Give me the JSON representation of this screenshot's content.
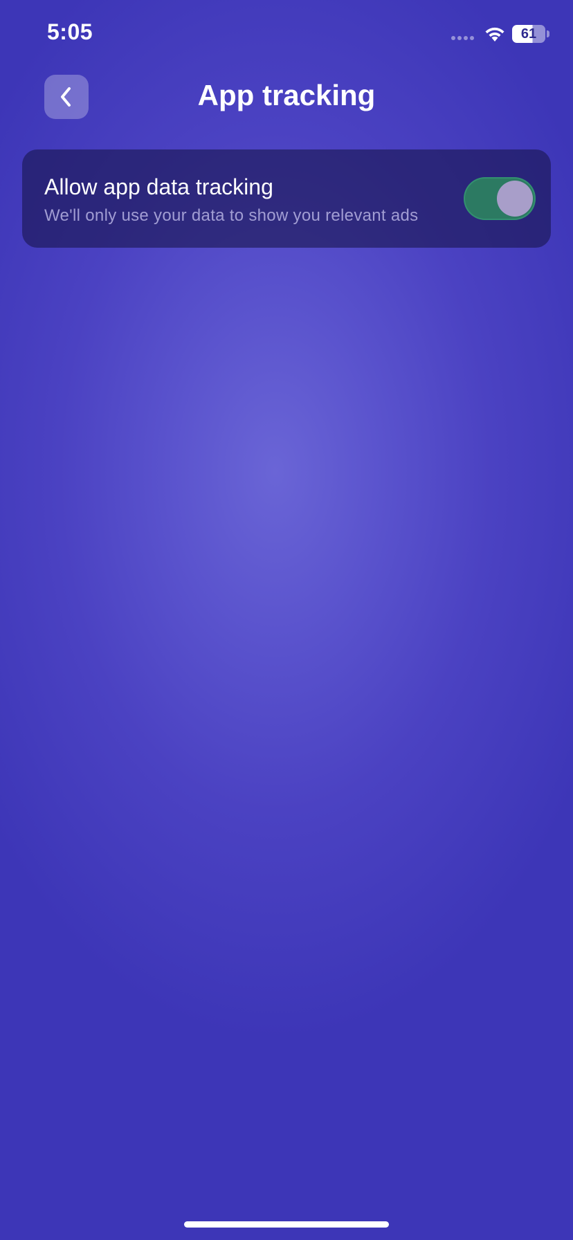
{
  "status_bar": {
    "time": "5:05",
    "battery_level": "61"
  },
  "header": {
    "title": "App tracking",
    "back_icon": "chevron-left-icon"
  },
  "settings": {
    "tracking": {
      "title": "Allow app data tracking",
      "subtitle": "We'll only use your data to show you relevant ads",
      "enabled": true,
      "toggle_on_color": "#2c7a62"
    }
  },
  "colors": {
    "background": "#4b42c2",
    "card": "#1a1650"
  }
}
